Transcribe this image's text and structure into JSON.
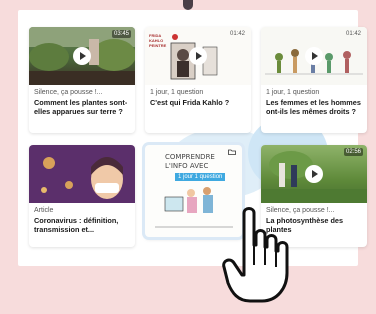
{
  "cards": [
    {
      "meta": "Silence, ça pousse !...",
      "title": "Comment les plantes sont-elles apparues sur terre ?",
      "duration": "03:45"
    },
    {
      "meta": "1 jour, 1 question",
      "title": "C'est qui Frida Kahlo ?",
      "duration": "01:42",
      "thumb_text": [
        "FRIDA",
        "KAHLO",
        "PEINTRE"
      ]
    },
    {
      "meta": "1 jour, 1 question",
      "title": "Les femmes et les hommes ont-ils les mêmes droits ?",
      "duration": "01:42"
    },
    {
      "meta": "Article",
      "title": "Coronavirus : définition, transmission et..."
    },
    {
      "thumb_text": [
        "COMPRENDRE",
        "L'INFO AVEC"
      ],
      "badge": "1 jour 1 question"
    },
    {
      "meta": "Silence, ça pousse !...",
      "title": "La photosynthèse des plantes",
      "duration": "02:56"
    }
  ],
  "colors": {
    "background": "#f7dcdc",
    "panel": "#ffffff",
    "accent_blue": "#3fa9e0"
  }
}
